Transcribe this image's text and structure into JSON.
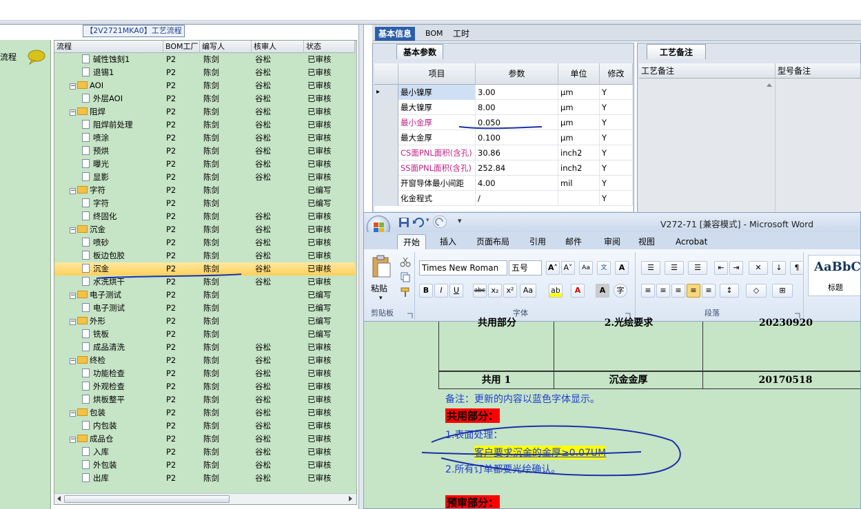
{
  "left_nav": {
    "label": "流程"
  },
  "tree": {
    "title": "【2V2721MKA0】工艺流程",
    "columns": [
      "流程",
      "BOM工厂",
      "编写人",
      "核审人",
      "状态"
    ],
    "rows": [
      {
        "level": 2,
        "type": "doc",
        "name": "碱性蚀刻1",
        "bom": "P2",
        "writer": "陈剑",
        "reviewer": "谷松",
        "status": "已审核"
      },
      {
        "level": 2,
        "type": "doc",
        "name": "退锡1",
        "bom": "P2",
        "writer": "陈剑",
        "reviewer": "谷松",
        "status": "已审核"
      },
      {
        "level": 1,
        "type": "folder",
        "name": "AOI",
        "bom": "P2",
        "writer": "陈剑",
        "reviewer": "谷松",
        "status": "已审核"
      },
      {
        "level": 2,
        "type": "doc",
        "name": "外层AOI",
        "bom": "P2",
        "writer": "陈剑",
        "reviewer": "谷松",
        "status": "已审核"
      },
      {
        "level": 1,
        "type": "folder",
        "name": "阻焊",
        "bom": "P2",
        "writer": "陈剑",
        "reviewer": "谷松",
        "status": "已审核"
      },
      {
        "level": 2,
        "type": "doc",
        "name": "阻焊前处理",
        "bom": "P2",
        "writer": "陈剑",
        "reviewer": "谷松",
        "status": "已审核"
      },
      {
        "level": 2,
        "type": "doc",
        "name": "喷涂",
        "bom": "P2",
        "writer": "陈剑",
        "reviewer": "谷松",
        "status": "已审核"
      },
      {
        "level": 2,
        "type": "doc",
        "name": "预烘",
        "bom": "P2",
        "writer": "陈剑",
        "reviewer": "谷松",
        "status": "已审核"
      },
      {
        "level": 2,
        "type": "doc",
        "name": "曝光",
        "bom": "P2",
        "writer": "陈剑",
        "reviewer": "谷松",
        "status": "已审核"
      },
      {
        "level": 2,
        "type": "doc",
        "name": "显影",
        "bom": "P2",
        "writer": "陈剑",
        "reviewer": "谷松",
        "status": "已审核"
      },
      {
        "level": 1,
        "type": "folder",
        "name": "字符",
        "bom": "P2",
        "writer": "陈剑",
        "reviewer": "",
        "status": "已编写"
      },
      {
        "level": 2,
        "type": "doc",
        "name": "字符",
        "bom": "P2",
        "writer": "陈剑",
        "reviewer": "",
        "status": "已编写"
      },
      {
        "level": 2,
        "type": "doc",
        "name": "终固化",
        "bom": "P2",
        "writer": "陈剑",
        "reviewer": "谷松",
        "status": "已审核"
      },
      {
        "level": 1,
        "type": "folder",
        "name": "沉金",
        "bom": "P2",
        "writer": "陈剑",
        "reviewer": "谷松",
        "status": "已审核"
      },
      {
        "level": 2,
        "type": "doc",
        "name": "喷砂",
        "bom": "P2",
        "writer": "陈剑",
        "reviewer": "谷松",
        "status": "已审核"
      },
      {
        "level": 2,
        "type": "doc",
        "name": "板边包胶",
        "bom": "P2",
        "writer": "陈剑",
        "reviewer": "谷松",
        "status": "已审核"
      },
      {
        "level": 2,
        "type": "doc",
        "name": "沉金",
        "bom": "P2",
        "writer": "陈剑",
        "reviewer": "谷松",
        "status": "已审核",
        "selected": true
      },
      {
        "level": 2,
        "type": "doc",
        "name": "水洗烘干",
        "bom": "P2",
        "writer": "陈剑",
        "reviewer": "谷松",
        "status": "已审核"
      },
      {
        "level": 1,
        "type": "folder",
        "name": "电子测试",
        "bom": "P2",
        "writer": "陈剑",
        "reviewer": "",
        "status": "已编写"
      },
      {
        "level": 2,
        "type": "doc",
        "name": "电子测试",
        "bom": "P2",
        "writer": "陈剑",
        "reviewer": "",
        "status": "已编写"
      },
      {
        "level": 1,
        "type": "folder",
        "name": "外形",
        "bom": "P2",
        "writer": "陈剑",
        "reviewer": "",
        "status": "已编写"
      },
      {
        "level": 2,
        "type": "doc",
        "name": "铣板",
        "bom": "P2",
        "writer": "陈剑",
        "reviewer": "",
        "status": "已编写"
      },
      {
        "level": 2,
        "type": "doc",
        "name": "成品清洗",
        "bom": "P2",
        "writer": "陈剑",
        "reviewer": "谷松",
        "status": "已审核"
      },
      {
        "level": 1,
        "type": "folder",
        "name": "终检",
        "bom": "P2",
        "writer": "陈剑",
        "reviewer": "谷松",
        "status": "已审核"
      },
      {
        "level": 2,
        "type": "doc",
        "name": "功能检查",
        "bom": "P2",
        "writer": "陈剑",
        "reviewer": "谷松",
        "status": "已审核"
      },
      {
        "level": 2,
        "type": "doc",
        "name": "外观检查",
        "bom": "P2",
        "writer": "陈剑",
        "reviewer": "谷松",
        "status": "已审核"
      },
      {
        "level": 2,
        "type": "doc",
        "name": "烘板整平",
        "bom": "P2",
        "writer": "陈剑",
        "reviewer": "谷松",
        "status": "已审核"
      },
      {
        "level": 1,
        "type": "folder",
        "name": "包装",
        "bom": "P2",
        "writer": "陈剑",
        "reviewer": "谷松",
        "status": "已审核"
      },
      {
        "level": 2,
        "type": "doc",
        "name": "内包装",
        "bom": "P2",
        "writer": "陈剑",
        "reviewer": "谷松",
        "status": "已审核"
      },
      {
        "level": 1,
        "type": "folder",
        "name": "成品仓",
        "bom": "P2",
        "writer": "陈剑",
        "reviewer": "谷松",
        "status": "已审核"
      },
      {
        "level": 2,
        "type": "doc",
        "name": "入库",
        "bom": "P2",
        "writer": "陈剑",
        "reviewer": "谷松",
        "status": "已审核"
      },
      {
        "level": 2,
        "type": "doc",
        "name": "外包装",
        "bom": "P2",
        "writer": "陈剑",
        "reviewer": "谷松",
        "status": "已审核"
      },
      {
        "level": 2,
        "type": "doc",
        "name": "出库",
        "bom": "P2",
        "writer": "陈剑",
        "reviewer": "谷松",
        "status": "已审核"
      }
    ]
  },
  "right_tabs": [
    "基本信息",
    "BOM",
    "工时"
  ],
  "params": {
    "tab": "基本参数",
    "columns": [
      "项目",
      "参数",
      "单位",
      "修改"
    ],
    "rows": [
      {
        "item": "最小镍厚",
        "value": "3.00",
        "unit": "μm",
        "mod": "Y",
        "magenta": false,
        "current": true
      },
      {
        "item": "最大镍厚",
        "value": "8.00",
        "unit": "μm",
        "mod": "Y",
        "magenta": false
      },
      {
        "item": "最小金厚",
        "value": "0.050",
        "unit": "μm",
        "mod": "Y",
        "magenta": true
      },
      {
        "item": "最大金厚",
        "value": "0.100",
        "unit": "μm",
        "mod": "Y",
        "magenta": false
      },
      {
        "item": "CS面PNL面积(含孔)",
        "value": "30.86",
        "unit": "inch2",
        "mod": "Y",
        "magenta": true
      },
      {
        "item": "SS面PNL面积(含孔)",
        "value": "252.84",
        "unit": "inch2",
        "mod": "Y",
        "magenta": true
      },
      {
        "item": "开窗导体最小间距",
        "value": "4.00",
        "unit": "mil",
        "mod": "Y",
        "magenta": false
      },
      {
        "item": "化金程式",
        "value": "/",
        "unit": "",
        "mod": "Y",
        "magenta": false
      }
    ]
  },
  "remarks": {
    "tab": "工艺备注",
    "columns": [
      "工艺备注",
      "型号备注"
    ]
  },
  "word": {
    "title": "V272-71 [兼容模式] - Microsoft Word",
    "tabs": [
      "开始",
      "插入",
      "页面布局",
      "引用",
      "邮件",
      "审阅",
      "视图",
      "Acrobat"
    ],
    "font_name": "Times New Roman",
    "font_size": "五号",
    "paste_label": "粘贴",
    "groups": {
      "clipboard": "剪贴板",
      "font": "字体",
      "paragraph": "段落"
    },
    "style_preview": "AaBbC",
    "style_name": "标题",
    "table": {
      "row1": [
        "共用部分",
        "2.光绘要求",
        "20230920"
      ],
      "row2": [
        "共用 1",
        "沉金金厚",
        "20170518"
      ]
    },
    "lines": {
      "note": "备注：更新的内容以蓝色字体显示。",
      "shared": "共用部分：",
      "surface": "1.表面处理：",
      "requirement": "客户要求沉金的金厚≥0.07UM",
      "photo": "2.所有订单都要光绘确认。",
      "prereview": "预审部分："
    }
  }
}
